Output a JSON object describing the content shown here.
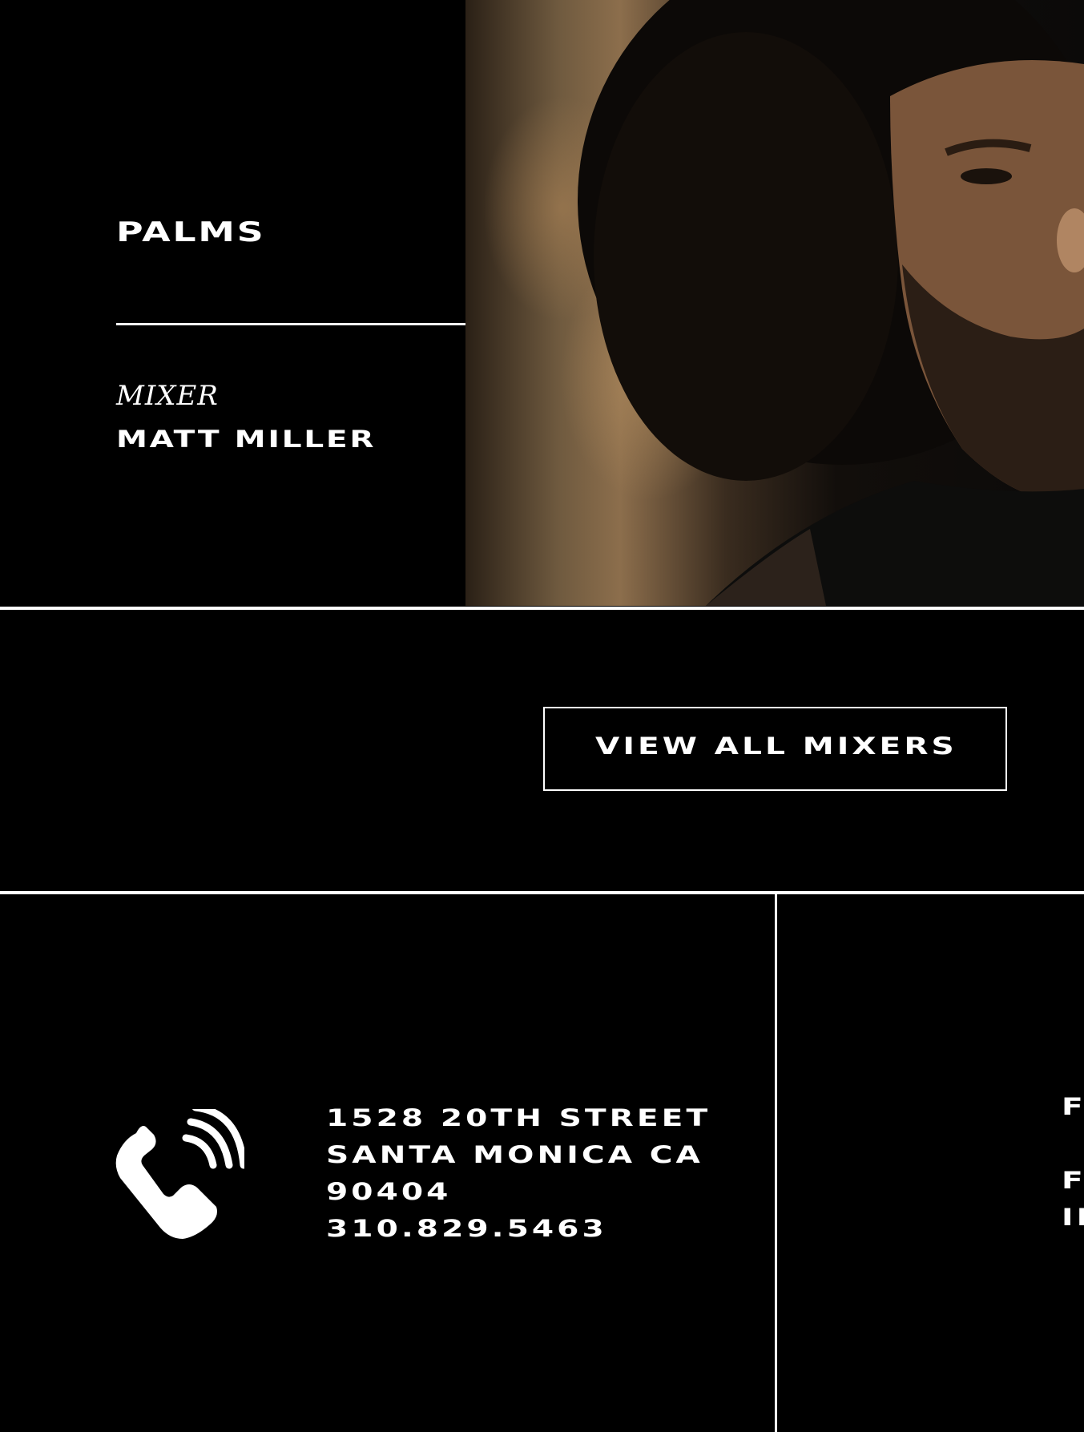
{
  "hero": {
    "title": "PALMS",
    "role": "MIXER",
    "name": "MATT MILLER"
  },
  "cta": {
    "label": "VIEW ALL MIXERS"
  },
  "contact": {
    "address_line1": "1528 20TH STREET",
    "address_line2": "SANTA MONICA CA",
    "zip": "90404",
    "phone": "310.829.5463",
    "icon": "phone-icon"
  },
  "right_column": {
    "line1": "F",
    "line2": "F",
    "line3": "IN"
  },
  "colors": {
    "background": "#000000",
    "text": "#ffffff",
    "lines": "#ffffff"
  }
}
